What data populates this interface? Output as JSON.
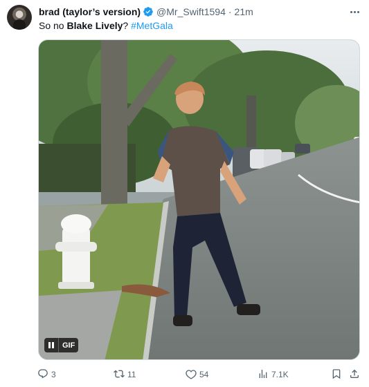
{
  "tweet": {
    "display_name": "brad (taylor’s version)",
    "handle": "@Mr_Swift1594",
    "separator": "·",
    "time": "21m",
    "text_prefix": "So no ",
    "text_bold": "Blake Lively",
    "text_mid": "? ",
    "hashtag": "#MetGala"
  },
  "media": {
    "type": "gif",
    "badge_label": "GIF"
  },
  "actions": {
    "replies": "3",
    "retweets": "11",
    "likes": "54",
    "views": "7.1K"
  },
  "colors": {
    "accent": "#1d9bf0",
    "secondary_text": "#536471",
    "primary_text": "#0f1419"
  },
  "icons": {
    "verified": "verified-badge-icon",
    "more": "more-dots-icon",
    "pause": "pause-icon",
    "reply": "reply-icon",
    "retweet": "retweet-icon",
    "like": "heart-icon",
    "views": "views-chart-icon",
    "bookmark": "bookmark-icon",
    "share": "share-icon"
  }
}
